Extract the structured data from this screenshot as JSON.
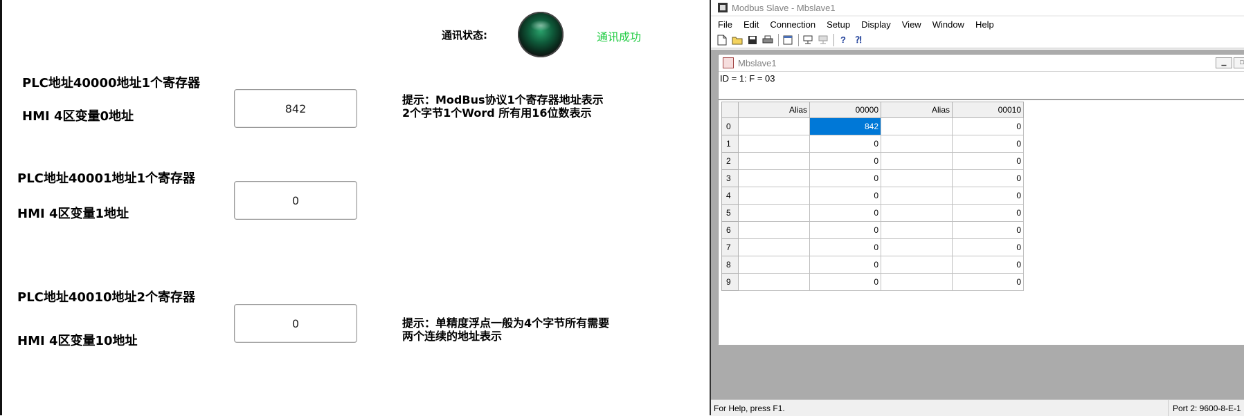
{
  "hmi": {
    "status_label": "通讯状态:",
    "status_value": "通讯成功",
    "status_color": "#22cc44",
    "group1": {
      "line1": "PLC地址40000地址1个寄存器",
      "line2": "HMI 4区变量0地址",
      "value": "842"
    },
    "group2": {
      "line1": "PLC地址40001地址1个寄存器",
      "line2": "HMI 4区变量1地址",
      "value": "0"
    },
    "group3": {
      "line1": "PLC地址40010地址2个寄存器",
      "line2": "HMI 4区变量10地址",
      "value": "0"
    },
    "tip1": "提示：ModBus协议1个寄存器地址表示2个字节1个Word 所有用16位数表示",
    "tip2": "提示：单精度浮点一般为4个字节所有需要两个连续的地址表示"
  },
  "modbus": {
    "title": "Modbus Slave - Mbslave1",
    "menu": [
      "File",
      "Edit",
      "Connection",
      "Setup",
      "Display",
      "View",
      "Window",
      "Help"
    ],
    "toolbar_icons": [
      "new-file-icon",
      "open-folder-icon",
      "save-icon",
      "print-icon",
      "window-icon",
      "connect-icon",
      "disconnect-icon",
      "help-icon",
      "context-help-icon"
    ],
    "child_title": "Mbslave1",
    "info": "ID = 1: F = 03",
    "columns": [
      "Alias",
      "00000",
      "Alias",
      "00010"
    ],
    "rows": [
      {
        "idx": "0",
        "a1": "",
        "v1": "842",
        "a2": "",
        "v2": "0"
      },
      {
        "idx": "1",
        "a1": "",
        "v1": "0",
        "a2": "",
        "v2": "0"
      },
      {
        "idx": "2",
        "a1": "",
        "v1": "0",
        "a2": "",
        "v2": "0"
      },
      {
        "idx": "3",
        "a1": "",
        "v1": "0",
        "a2": "",
        "v2": "0"
      },
      {
        "idx": "4",
        "a1": "",
        "v1": "0",
        "a2": "",
        "v2": "0"
      },
      {
        "idx": "5",
        "a1": "",
        "v1": "0",
        "a2": "",
        "v2": "0"
      },
      {
        "idx": "6",
        "a1": "",
        "v1": "0",
        "a2": "",
        "v2": "0"
      },
      {
        "idx": "7",
        "a1": "",
        "v1": "0",
        "a2": "",
        "v2": "0"
      },
      {
        "idx": "8",
        "a1": "",
        "v1": "0",
        "a2": "",
        "v2": "0"
      },
      {
        "idx": "9",
        "a1": "",
        "v1": "0",
        "a2": "",
        "v2": "0"
      }
    ],
    "selected_color": "#0078d7",
    "status_help": "For Help, press F1.",
    "status_port": "Port 2: 9600-8-E-1"
  }
}
